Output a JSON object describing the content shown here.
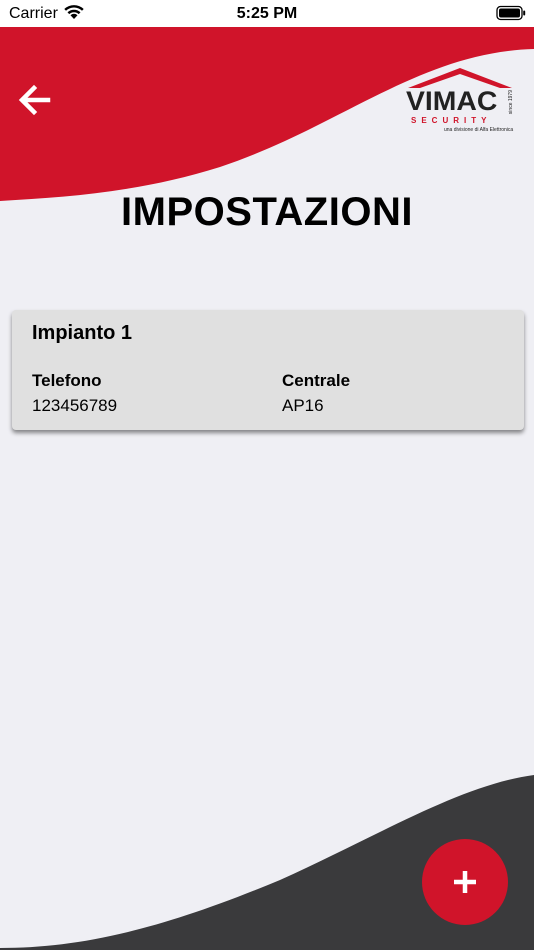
{
  "status_bar": {
    "carrier": "Carrier",
    "time": "5:25 PM"
  },
  "header": {
    "back_icon": "arrow-left-icon"
  },
  "logo": {
    "wordmark": "VIMAC",
    "since": "since 1979",
    "security": "SECURITY",
    "tagline": "una divisione di Alfa Elettronica"
  },
  "page": {
    "title": "IMPOSTAZIONI"
  },
  "systems": [
    {
      "name": "Impianto 1",
      "phone_label": "Telefono",
      "phone_value": "123456789",
      "panel_label": "Centrale",
      "panel_value": "AP16"
    }
  ],
  "fab": {
    "icon": "plus-icon"
  },
  "colors": {
    "brand_red": "#D0142A",
    "dark_gray": "#3A3A3C",
    "background": "#EFEFF4",
    "card": "#E0E0E0"
  }
}
